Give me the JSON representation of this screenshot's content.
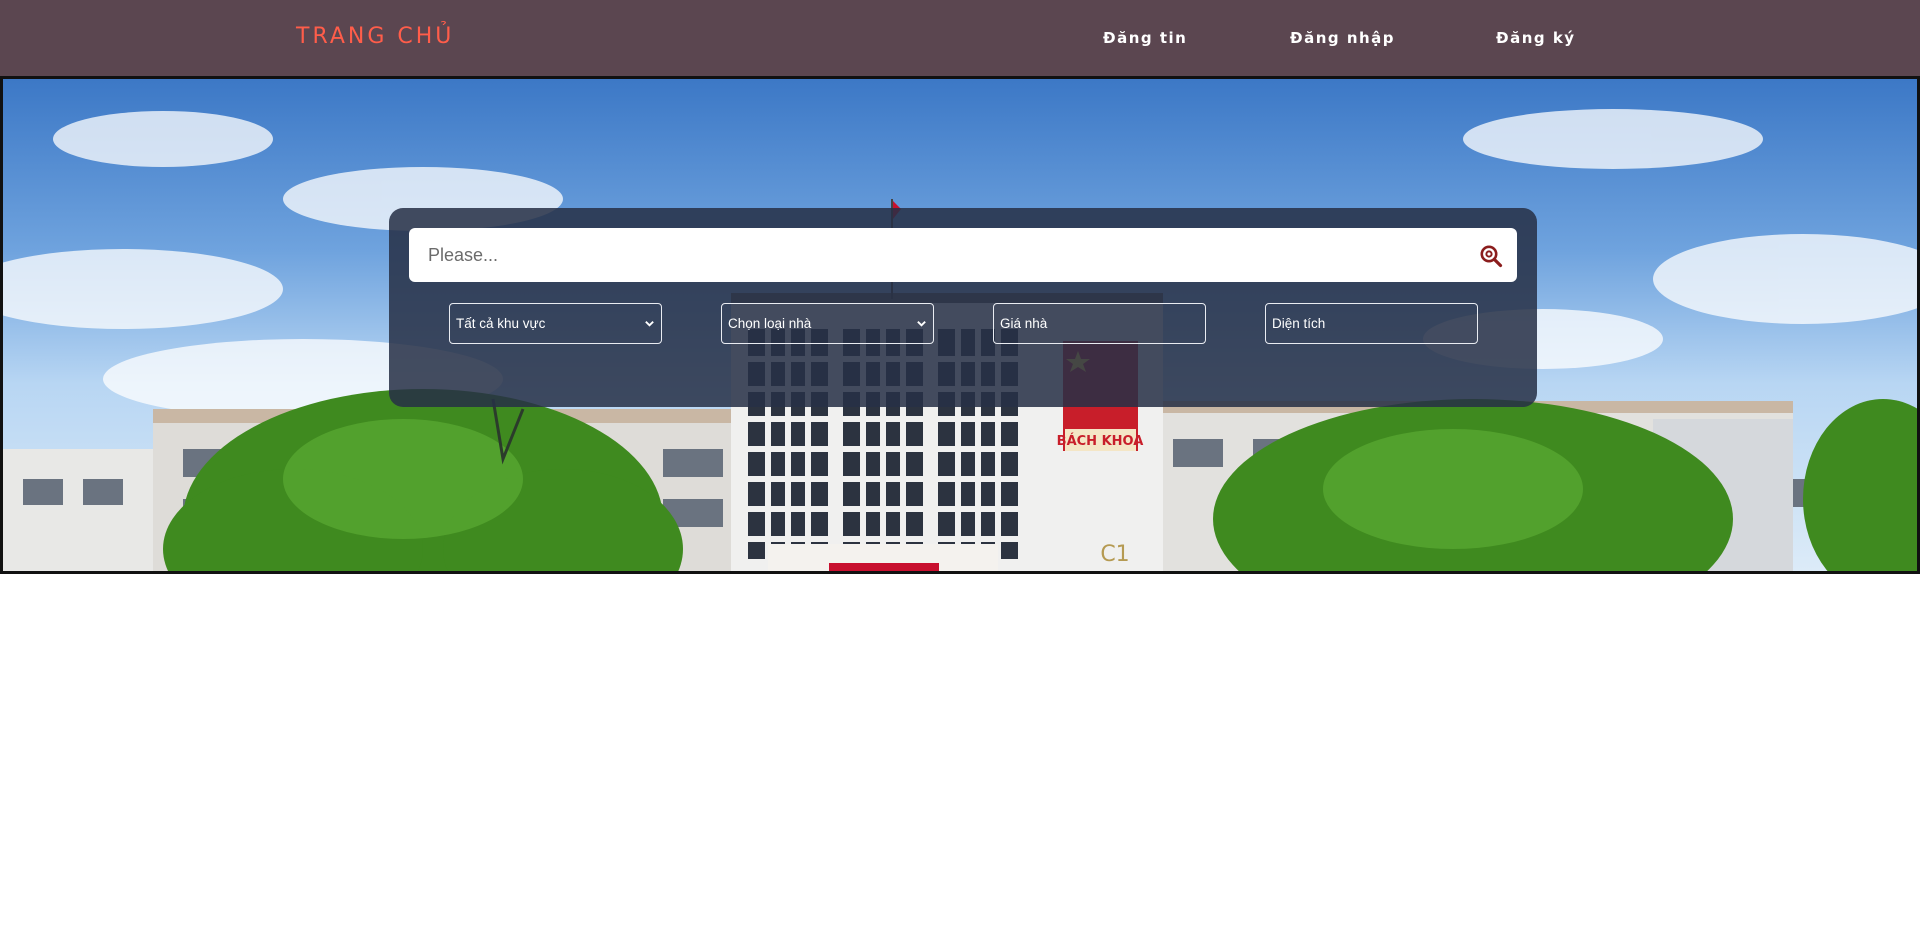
{
  "nav": {
    "brand": "TRANG CHỦ",
    "links": [
      "Đăng tin",
      "Đăng nhập",
      "Đăng ký"
    ],
    "brand_color": "#ff5d4a",
    "bar_color": "#5b4650"
  },
  "hero": {
    "banner_text": "BÁCH KHOA",
    "building_label": "C1"
  },
  "search": {
    "placeholder": "Please...",
    "icon": "search-icon"
  },
  "filters": {
    "area_select": "Tất cả khu vực",
    "type_select": "Chọn loại nhà",
    "price_input": "Giá nhà",
    "size_input": "Diện tích"
  },
  "colors": {
    "accent": "#8b1d1d"
  }
}
